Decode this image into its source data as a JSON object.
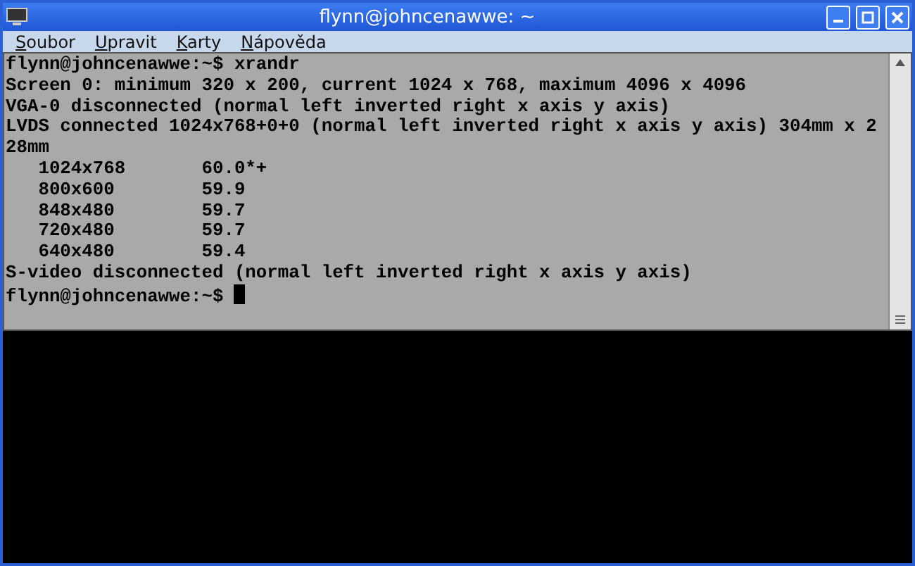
{
  "window": {
    "title": "flynn@johncenawwe: ~"
  },
  "menu": [
    "Soubor",
    "Upravit",
    "Karty",
    "Nápověda"
  ],
  "terminal": {
    "lines": [
      "flynn@johncenawwe:~$ xrandr",
      "Screen 0: minimum 320 x 200, current 1024 x 768, maximum 4096 x 4096",
      "VGA-0 disconnected (normal left inverted right x axis y axis)",
      "LVDS connected 1024x768+0+0 (normal left inverted right x axis y axis) 304mm x 2",
      "28mm",
      "   1024x768       60.0*+",
      "   800x600        59.9",
      "   848x480        59.7",
      "   720x480        59.7",
      "   640x480        59.4",
      "S-video disconnected (normal left inverted right x axis y axis)"
    ],
    "prompt": "flynn@johncenawwe:~$ "
  }
}
